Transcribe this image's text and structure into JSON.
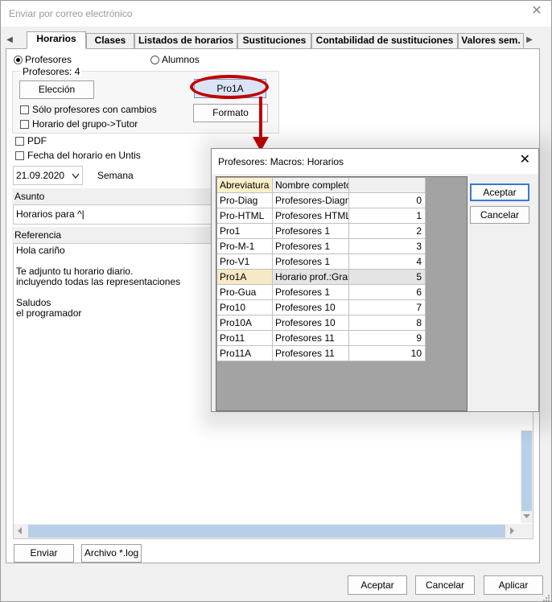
{
  "window": {
    "title": "Enviar por correo electrónico",
    "close_glyph": "✕"
  },
  "tabs": {
    "left_arrow": "◀",
    "right_arrow": "▶",
    "items": [
      "Horarios",
      "Clases",
      "Listados de horarios",
      "Sustituciones",
      "Contabilidad de sustituciones",
      "Valores sem."
    ]
  },
  "recipients": {
    "profesores_label": "Profesores",
    "alumnos_label": "Alumnos",
    "count_text": "Profesores: 4",
    "eleccion_button": "Elección",
    "solo_cambios_label": "Sólo profesores con cambios",
    "grupo_tutor_label": "Horario del grupo->Tutor",
    "macro_button": "Pro1A",
    "formato_button": "Formato"
  },
  "options": {
    "pdf_label": "PDF",
    "fecha_label": "Fecha del horario en Untis",
    "date_value": "21.09.2020",
    "semana_label": "Semana"
  },
  "asunto": {
    "label": "Asunto",
    "value": "Horarios para ^|"
  },
  "referencia": {
    "label": "Referencia",
    "lines": [
      "Hola cariño",
      "",
      "Te adjunto tu horario diario.",
      "incluyendo todas las representaciones",
      "",
      "Saludos",
      "el programador"
    ]
  },
  "bottom_buttons": {
    "enviar": "Enviar",
    "archivo_log": "Archivo *.log"
  },
  "dialog_buttons": {
    "aceptar": "Aceptar",
    "cancelar": "Cancelar",
    "aplicar": "Aplicar"
  },
  "popup": {
    "title": "Profesores: Macros: Horarios",
    "close_glyph": "✕",
    "aceptar": "Aceptar",
    "cancelar": "Cancelar",
    "columns": [
      "Abreviatura",
      "Nombre completo",
      ""
    ],
    "rows": [
      [
        "Pro-Diag",
        "Profesores-Diagnó",
        "0"
      ],
      [
        "Pro-HTML",
        "Profesores HTML",
        "1"
      ],
      [
        "Pro1",
        "Profesores 1",
        "2"
      ],
      [
        "Pro-M-1",
        "Profesores 1",
        "3"
      ],
      [
        "Pro-V1",
        "Profesores 1",
        "4"
      ],
      [
        "Pro1A",
        "Horario prof.:Gran",
        "5"
      ],
      [
        "Pro-Gua",
        "Profesores 1",
        "6"
      ],
      [
        "Pro10",
        "Profesores 10",
        "7"
      ],
      [
        "Pro10A",
        "Profesores 10",
        "8"
      ],
      [
        "Pro11",
        "Profesores 11",
        "9"
      ],
      [
        "Pro11A",
        "Profesores 11",
        "10"
      ]
    ],
    "selected_row": 5
  },
  "colors": {
    "annotation": "#c00000",
    "scroll_blue": "#b8cfe8"
  }
}
